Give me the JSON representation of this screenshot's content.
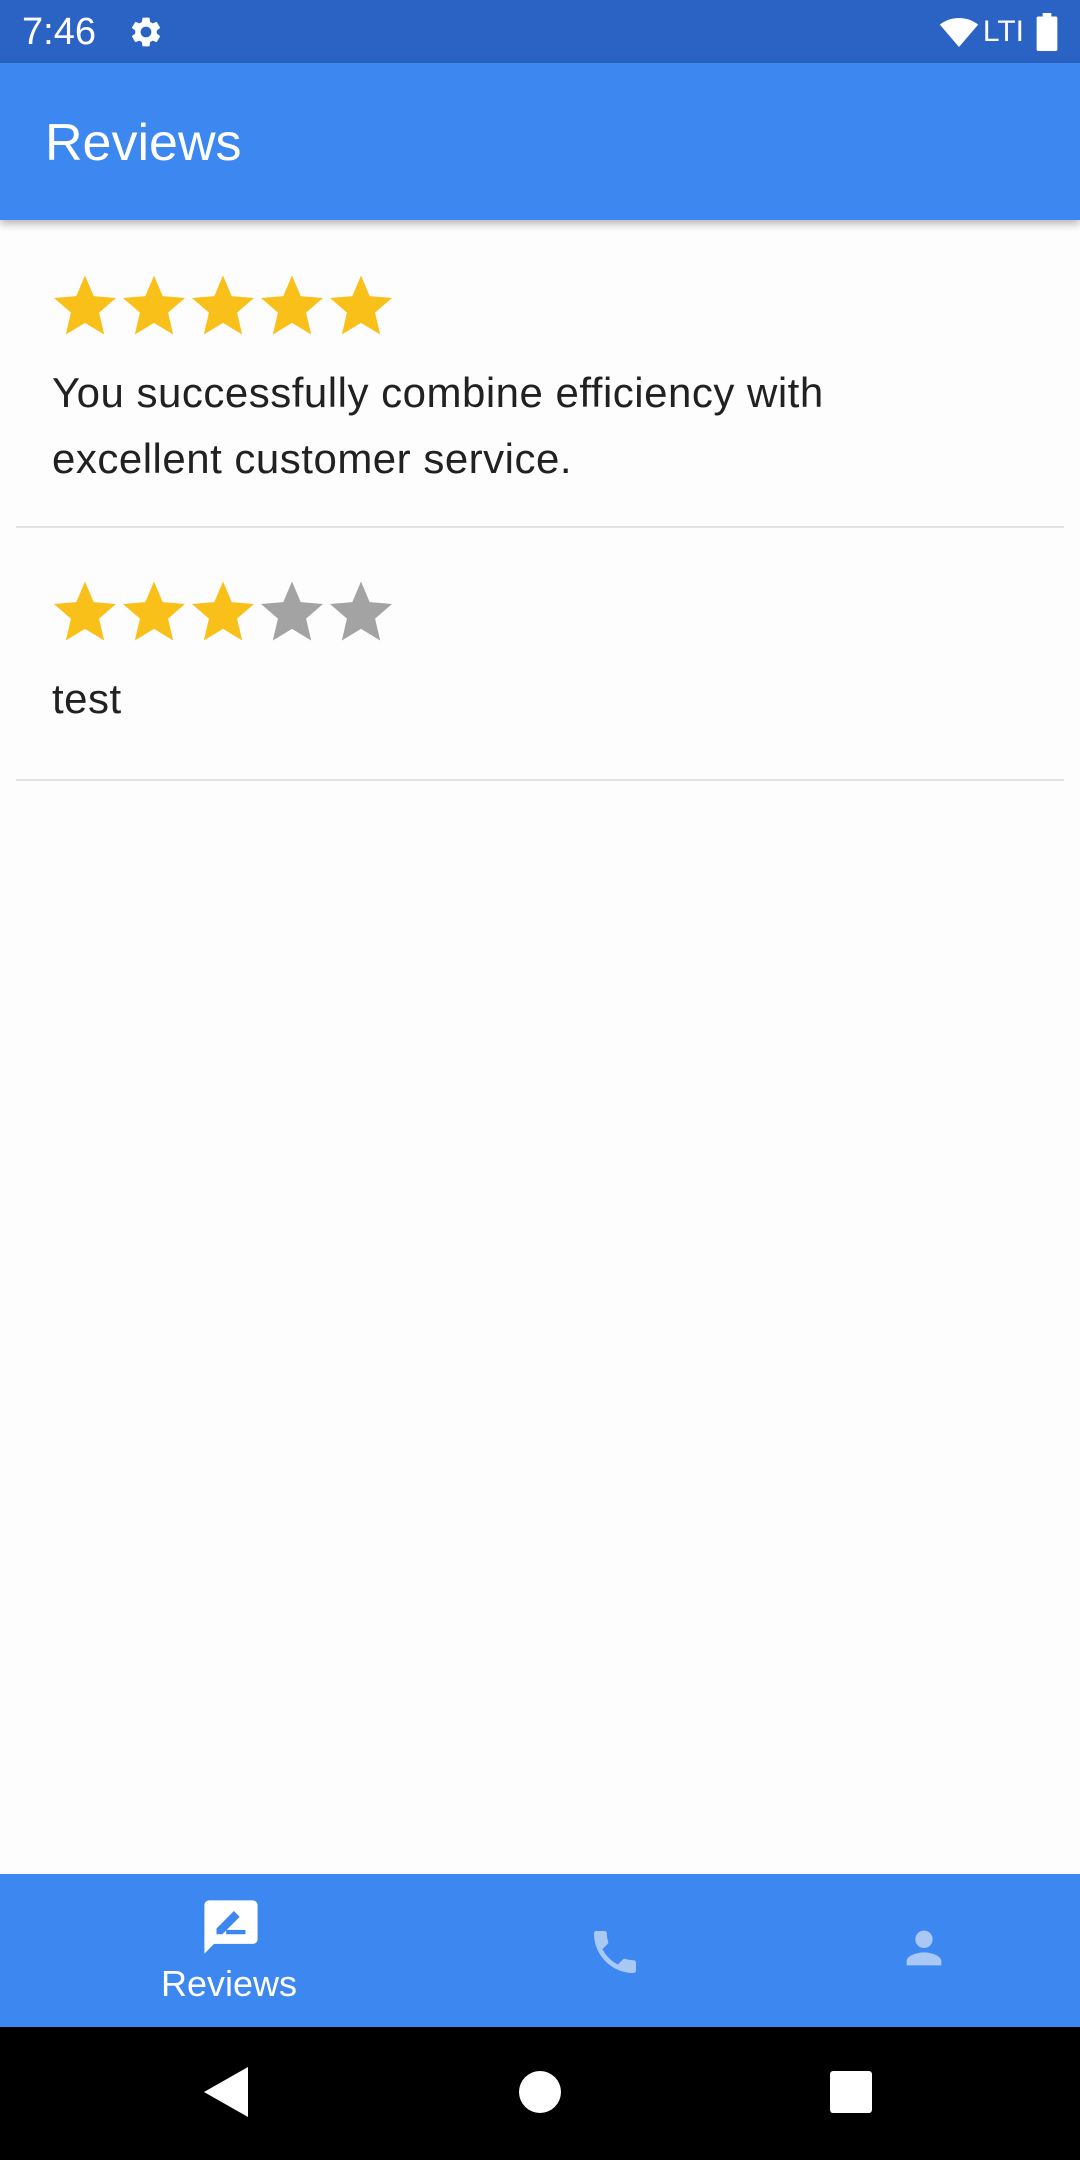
{
  "status_bar": {
    "time": "7:46",
    "settings_icon": "gear-icon",
    "wifi_icon": "wifi-icon",
    "network_label": "LTI",
    "battery_icon": "battery-icon",
    "background": "#2a63c4"
  },
  "app_bar": {
    "title": "Reviews",
    "background": "#3d87f0"
  },
  "reviews": [
    {
      "rating": 5,
      "max_rating": 5,
      "text": "You successfully combine efficiency with excellent customer service."
    },
    {
      "rating": 3,
      "max_rating": 5,
      "text": "test"
    }
  ],
  "colors": {
    "star_filled": "#f9c01a",
    "star_empty": "#a3a3a3",
    "accent": "#3d87f0"
  },
  "bottom_nav": {
    "items": [
      {
        "id": "reviews",
        "label": "Reviews",
        "icon": "rate-review-icon",
        "selected": true
      },
      {
        "id": "phone",
        "label": "",
        "icon": "phone-icon",
        "selected": false
      },
      {
        "id": "profile",
        "label": "",
        "icon": "person-icon",
        "selected": false
      }
    ]
  },
  "system_nav": {
    "back_icon": "back-triangle-icon",
    "home_icon": "home-circle-icon",
    "recents_icon": "recents-square-icon"
  }
}
